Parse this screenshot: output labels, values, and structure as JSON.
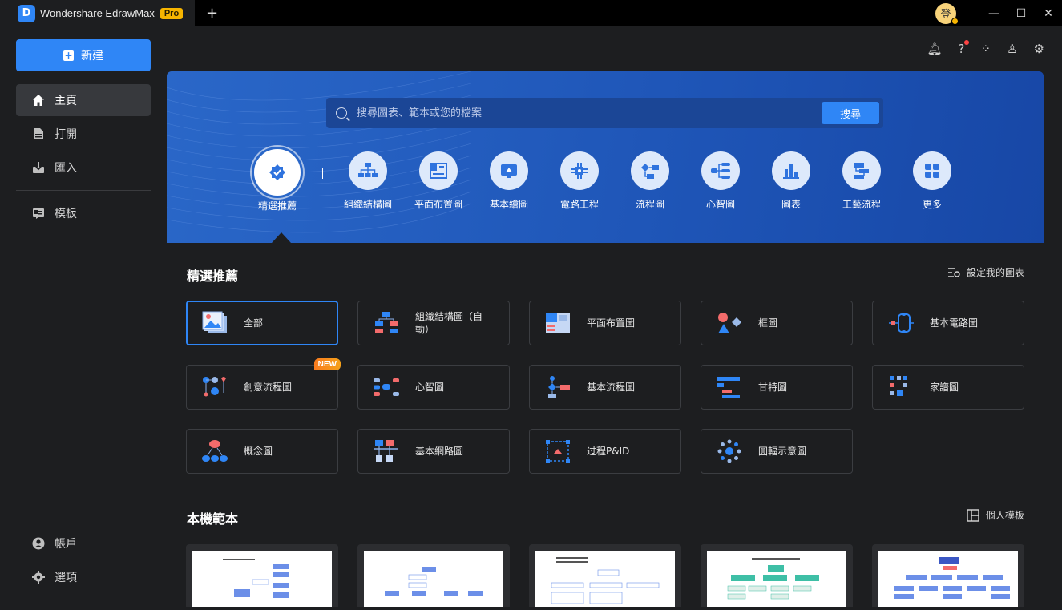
{
  "titlebar": {
    "app_name": "Wondershare EdrawMax",
    "badge": "Pro",
    "new_tab": "+",
    "avatar_text": "登",
    "minimize": "—",
    "maximize": "☐",
    "close": "✕"
  },
  "sidebar": {
    "new_button": "新建",
    "items": [
      {
        "label": "主頁",
        "icon": "home-icon"
      },
      {
        "label": "打開",
        "icon": "file-icon"
      },
      {
        "label": "匯入",
        "icon": "import-icon"
      },
      {
        "label": "模板",
        "icon": "template-icon"
      }
    ],
    "bottom": [
      {
        "label": "帳戶",
        "icon": "account-icon"
      },
      {
        "label": "選項",
        "icon": "settings-icon"
      }
    ]
  },
  "topbar": {
    "icons": [
      "bell-icon",
      "help-icon",
      "apps-icon",
      "theme-icon",
      "gear-icon"
    ]
  },
  "banner": {
    "search_placeholder": "搜尋圖表、範本或您的檔案",
    "search_button": "搜尋",
    "categories": [
      "精選推薦",
      "組織結構圖",
      "平面布置圖",
      "基本繪圖",
      "電路工程",
      "流程圖",
      "心智圖",
      "圖表",
      "工藝流程",
      "更多"
    ]
  },
  "featured": {
    "title": "精選推薦",
    "link": "設定我的圖表",
    "cards": [
      "全部",
      "組織結構圖（自動）",
      "平面布置圖",
      "框圖",
      "基本電路圖",
      "創意流程圖",
      "心智圖",
      "基本流程圖",
      "甘特圖",
      "家譜圖",
      "概念圖",
      "基本網路圖",
      "过程P&ID",
      "圓輻示意圖"
    ],
    "new_badge": "NEW"
  },
  "local": {
    "title": "本機範本",
    "link": "個人模板"
  },
  "colors": {
    "accent": "#2f86f6",
    "banner": "#1f56b8",
    "bg": "#1d1e20",
    "badge": "#f7b500"
  }
}
